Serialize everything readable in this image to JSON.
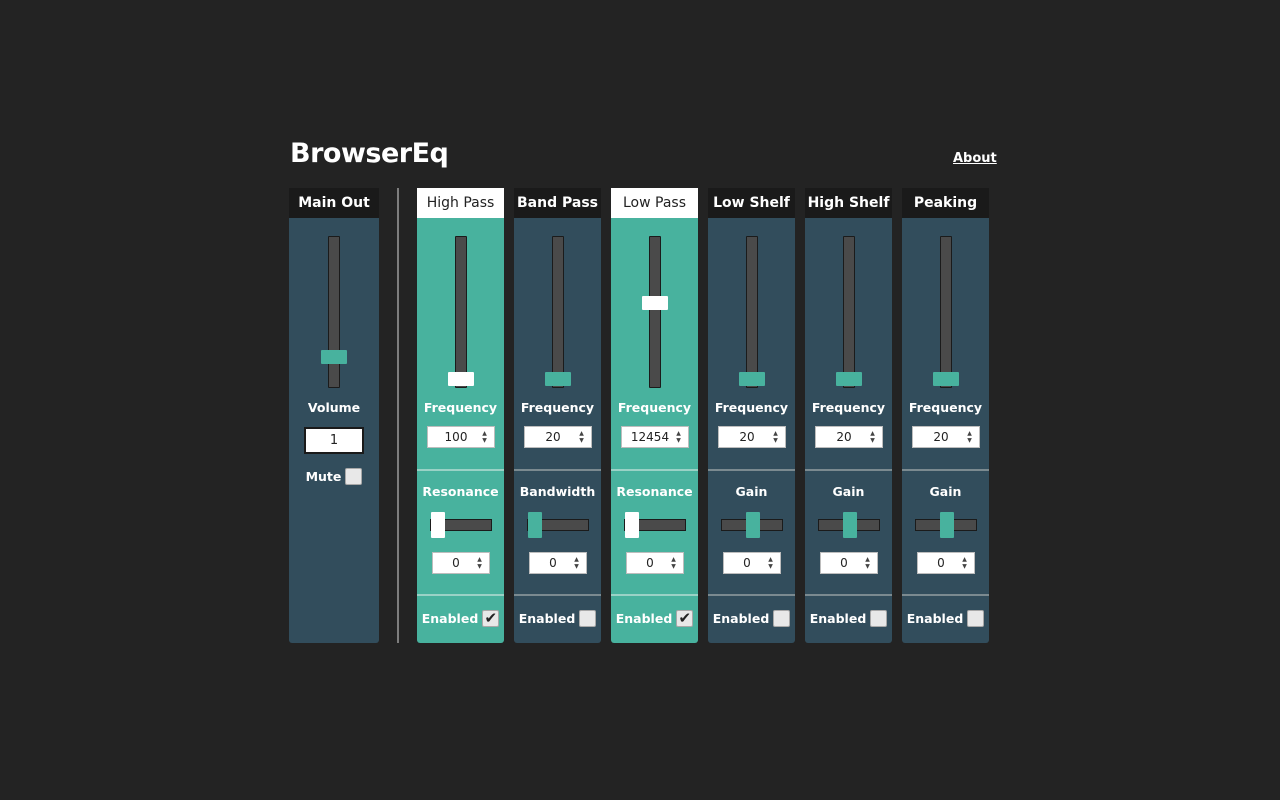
{
  "app": {
    "title": "BrowserEq",
    "about": "About"
  },
  "main_out": {
    "title": "Main Out",
    "volume_label": "Volume",
    "volume_value": "1",
    "volume_level": 0.2,
    "mute_label": "Mute",
    "mute_checked": false
  },
  "filters": [
    {
      "title": "High Pass",
      "active": true,
      "freq_label": "Frequency",
      "freq_value": "100",
      "freq_level": 0.05,
      "param_label": "Resonance",
      "param_value": "0",
      "param_level": 0.0,
      "enabled_label": "Enabled",
      "enabled": true
    },
    {
      "title": "Band Pass",
      "active": false,
      "freq_label": "Frequency",
      "freq_value": "20",
      "freq_level": 0.05,
      "param_label": "Bandwidth",
      "param_value": "0",
      "param_level": 0.0,
      "enabled_label": "Enabled",
      "enabled": false
    },
    {
      "title": "Low Pass",
      "active": true,
      "freq_label": "Frequency",
      "freq_value": "12454",
      "freq_level": 0.55,
      "param_label": "Resonance",
      "param_value": "0",
      "param_level": 0.0,
      "enabled_label": "Enabled",
      "enabled": true
    },
    {
      "title": "Low Shelf",
      "active": false,
      "freq_label": "Frequency",
      "freq_value": "20",
      "freq_level": 0.05,
      "param_label": "Gain",
      "param_value": "0",
      "param_level": 0.5,
      "enabled_label": "Enabled",
      "enabled": false
    },
    {
      "title": "High Shelf",
      "active": false,
      "freq_label": "Frequency",
      "freq_value": "20",
      "freq_level": 0.05,
      "param_label": "Gain",
      "param_value": "0",
      "param_level": 0.5,
      "enabled_label": "Enabled",
      "enabled": false
    },
    {
      "title": "Peaking",
      "active": false,
      "freq_label": "Frequency",
      "freq_value": "20",
      "freq_level": 0.05,
      "param_label": "Gain",
      "param_value": "0",
      "param_level": 0.5,
      "enabled_label": "Enabled",
      "enabled": false
    }
  ],
  "colors": {
    "background": "#232323",
    "panel": "#324d5c",
    "active_panel": "#48b29e",
    "accent": "#48b29e"
  },
  "icons": {
    "spinner": "spin-arrows-icon",
    "check": "checkmark-icon"
  }
}
